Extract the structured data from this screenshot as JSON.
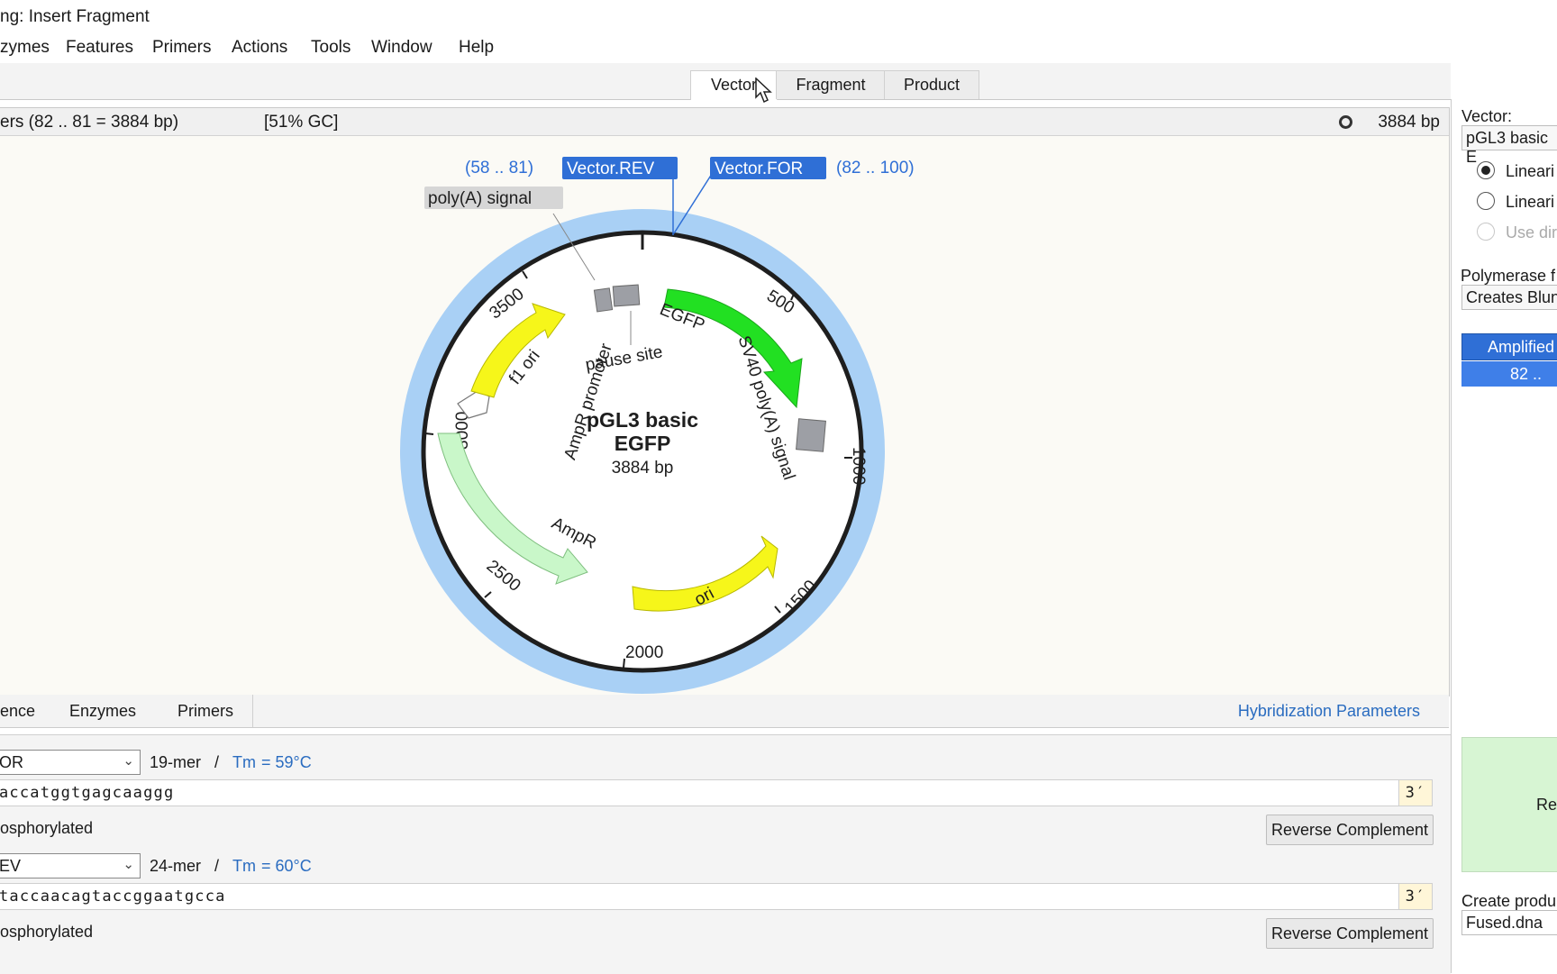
{
  "window": {
    "title": "ng: Insert Fragment"
  },
  "menu": [
    {
      "label": "zymes"
    },
    {
      "label": "Features"
    },
    {
      "label": "Primers"
    },
    {
      "label": "Actions"
    },
    {
      "label": "Tools"
    },
    {
      "label": "Window"
    },
    {
      "label": "Help"
    }
  ],
  "tabs": {
    "vector": "Vector",
    "fragment": "Fragment",
    "product": "Product",
    "active": "Vector"
  },
  "info": {
    "range": "ers  (82 .. 81  =  3884 bp)",
    "gc": "[51% GC]",
    "total": "3884 bp"
  },
  "map": {
    "name_line1": "pGL3 basic",
    "name_line2": "EGFP",
    "length": "3884 bp",
    "primer_rev_range": "(58 .. 81)",
    "primer_rev_label": "Vector.REV",
    "primer_for_label": "Vector.FOR",
    "primer_for_range": "(82 .. 100)",
    "polya_label": "poly(A) signal",
    "ticks": [
      "500",
      "1000",
      "1500",
      "2000",
      "2500",
      "3000",
      "3500"
    ],
    "features": {
      "egfp": "EGFP",
      "sv40": "SV40 poly(A) signal",
      "ori": "ori",
      "ampr": "AmpR",
      "ampr_promoter": "AmpR promoter",
      "f1ori": "f1 ori",
      "pause": "pause site"
    },
    "colors": {
      "ring": "#a9d0f5",
      "backbone": "#1e1e1e",
      "egfp": "#22e022",
      "ori": "#f6f61a",
      "ampr": "#c9f7c9",
      "grey": "#9d9fa5",
      "primer_tag": "#2f6fd6"
    }
  },
  "bottom_tabs": {
    "sequence": "ence",
    "enzymes": "Enzymes",
    "primers": "Primers",
    "hybridization": "Hybridization Parameters"
  },
  "primer_for": {
    "name": "OR",
    "mer": "19-mer",
    "slash": "/",
    "tm_label": "Tm",
    "tm_value": "=  59°C",
    "sequence": "accatggtgagcaaggg",
    "end": "3′",
    "phosphorylated": "osphorylated",
    "revcomp": "Reverse Complement"
  },
  "primer_rev": {
    "name": "EV",
    "mer": "24-mer",
    "slash": "/",
    "tm_label": "Tm",
    "tm_value": "=  60°C",
    "sequence": "taccaacagtaccggaatgcca",
    "end": "3′",
    "phosphorylated": "osphorylated",
    "revcomp": "Reverse Complement"
  },
  "right": {
    "vector_label": "Vector:",
    "vector_value": "pGL3 basic E",
    "opt1": "Lineari",
    "opt2": "Lineari",
    "opt3": "Use dir",
    "polymerase_label": "Polymerase f",
    "polymerase_value": "Creates Blun",
    "amplified_header": "Amplified",
    "amplified_value": "82  ..",
    "ready": "Rea",
    "create_label": "Create produ",
    "filename": "Fused.dna"
  }
}
